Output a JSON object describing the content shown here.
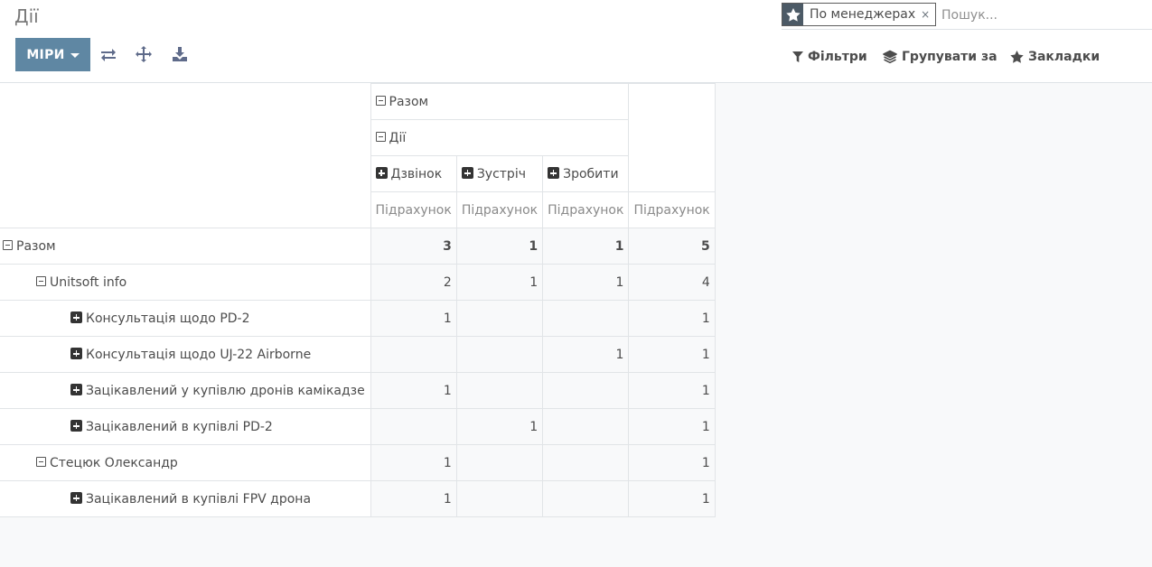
{
  "header": {
    "title": "Дії",
    "measures_label": "МІРИ",
    "icons": [
      "swap-axes-icon",
      "expand-all-icon",
      "download-icon"
    ]
  },
  "search": {
    "facet_icon": "star-icon",
    "facet_value": "По менеджерах",
    "facet_remove": "×",
    "placeholder": "Пошук..."
  },
  "panel": {
    "filters_label": "Фільтри",
    "filters_icon": "filter-icon",
    "group_label": "Групувати за",
    "group_icon": "layers-icon",
    "favorites_label": "Закладки",
    "favorites_icon": "star-icon"
  },
  "pivot": {
    "col_total": "Разом",
    "col_group": "Дії",
    "columns": [
      "Дзвінок",
      "Зустріч",
      "Зробити"
    ],
    "measure": "Підрахунок",
    "rows": [
      {
        "label": "Разом",
        "level": 0,
        "toggle": "minus",
        "values": [
          "3",
          "1",
          "1",
          "5"
        ]
      },
      {
        "label": "Unitsoft info",
        "level": 1,
        "toggle": "minus",
        "values": [
          "2",
          "1",
          "1",
          "4"
        ]
      },
      {
        "label": "Консультація щодо PD-2",
        "level": 2,
        "toggle": "plus",
        "values": [
          "1",
          "",
          "",
          "1"
        ]
      },
      {
        "label": "Консультація щодо UJ-22 Airborne",
        "level": 2,
        "toggle": "plus",
        "values": [
          "",
          "",
          "1",
          "1"
        ]
      },
      {
        "label": "Зацікавлений у купівлю дронів камікадзе",
        "level": 2,
        "toggle": "plus",
        "values": [
          "1",
          "",
          "",
          "1"
        ]
      },
      {
        "label": "Зацікавлений в купівлі PD-2",
        "level": 2,
        "toggle": "plus",
        "values": [
          "",
          "1",
          "",
          "1"
        ]
      },
      {
        "label": "Стецюк Олександр",
        "level": 1,
        "toggle": "minus",
        "values": [
          "1",
          "",
          "",
          "1"
        ]
      },
      {
        "label": "Зацікавлений в купівлі FPV дрона",
        "level": 2,
        "toggle": "plus",
        "values": [
          "1",
          "",
          "",
          "1"
        ]
      }
    ]
  }
}
